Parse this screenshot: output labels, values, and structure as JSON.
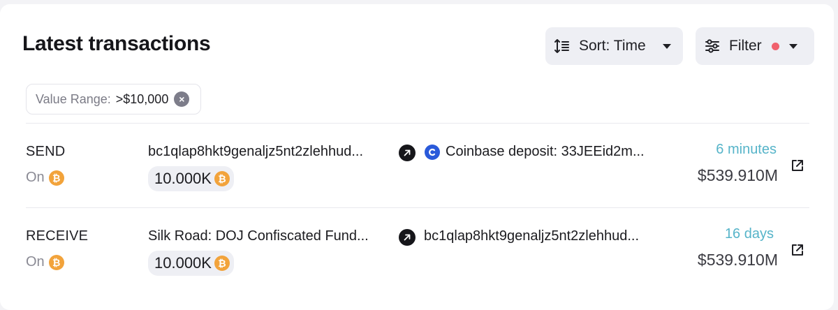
{
  "header": {
    "title": "Latest transactions",
    "sort_label": "Sort: Time",
    "filter_label": "Filter",
    "filter_active_color": "#f0616d"
  },
  "active_filter": {
    "key": "Value Range:",
    "value": ">$10,000"
  },
  "transactions": [
    {
      "type": "SEND",
      "chain_label": "On",
      "chain_icon": "bitcoin-icon",
      "from": "bc1qlap8hkt9genaljz5nt2zlehhud...",
      "to": "Coinbase deposit: 33JEEid2m...",
      "to_icon": "coinbase-icon",
      "amount": "10.000K",
      "time": "6 minutes",
      "usd_value": "$539.910M"
    },
    {
      "type": "RECEIVE",
      "chain_label": "On",
      "chain_icon": "bitcoin-icon",
      "from": "Silk Road: DOJ Confiscated Fund...",
      "to": "bc1qlap8hkt9genaljz5nt2zlehhud...",
      "amount": "10.000K",
      "time": "16 days",
      "usd_value": "$539.910M"
    }
  ],
  "colors": {
    "time_accent": "#56b4c9",
    "bitcoin": "#f2a33b",
    "coinbase": "#2a5ada"
  }
}
